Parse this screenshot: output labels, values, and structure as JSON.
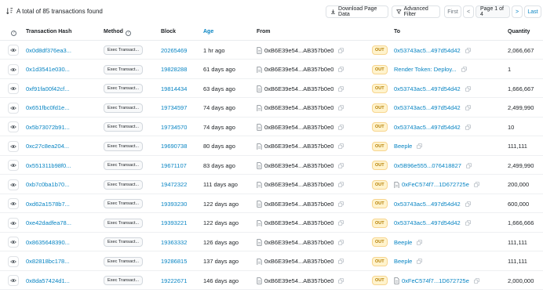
{
  "header": {
    "summary": "A total of 85 transactions found",
    "download_label": "Download Page Data",
    "filter_label": "Advanced Filter",
    "pager": {
      "first": "First",
      "prev": "<",
      "page": "Page 1 of 4",
      "next": ">",
      "last": "Last"
    }
  },
  "columns": {
    "hash": "Transaction Hash",
    "method": "Method",
    "block": "Block",
    "age": "Age",
    "from": "From",
    "to": "To",
    "quantity": "Quantity"
  },
  "rows": [
    {
      "hash": "0x0d8df376ea3...",
      "method": "Exec Transact...",
      "block": "20265469",
      "age": "1 hr ago",
      "from": "0xB6E39e54...AB357b0e0",
      "dir": "OUT",
      "to": "0x53743ac5...497d54d42",
      "to_contract": false,
      "qty": "2,066,667"
    },
    {
      "hash": "0x1d3541e030...",
      "method": "Exec Transact...",
      "block": "19828288",
      "age": "61 days ago",
      "from": "0xB6E39e54...AB357b0e0",
      "dir": "OUT",
      "to": "Render Token: Deploy...",
      "to_contract": false,
      "qty": "1"
    },
    {
      "hash": "0xf91fa00f42cf...",
      "method": "Exec Transact...",
      "block": "19814434",
      "age": "63 days ago",
      "from": "0xB6E39e54...AB357b0e0",
      "dir": "OUT",
      "to": "0x53743ac5...497d54d42",
      "to_contract": false,
      "qty": "1,666,667"
    },
    {
      "hash": "0x651fbc0fd1e...",
      "method": "Exec Transact...",
      "block": "19734597",
      "age": "74 days ago",
      "from": "0xB6E39e54...AB357b0e0",
      "dir": "OUT",
      "to": "0x53743ac5...497d54d42",
      "to_contract": false,
      "qty": "2,499,990"
    },
    {
      "hash": "0x5b73072b91...",
      "method": "Exec Transact...",
      "block": "19734570",
      "age": "74 days ago",
      "from": "0xB6E39e54...AB357b0e0",
      "dir": "OUT",
      "to": "0x53743ac5...497d54d42",
      "to_contract": false,
      "qty": "10"
    },
    {
      "hash": "0xc27c8ea204...",
      "method": "Exec Transact...",
      "block": "19690738",
      "age": "80 days ago",
      "from": "0xB6E39e54...AB357b0e0",
      "dir": "OUT",
      "to": "Beeple",
      "to_contract": false,
      "qty": "111,111"
    },
    {
      "hash": "0x551311b98f0...",
      "method": "Exec Transact...",
      "block": "19671107",
      "age": "83 days ago",
      "from": "0xB6E39e54...AB357b0e0",
      "dir": "OUT",
      "to": "0x5B96e555...076418827",
      "to_contract": false,
      "qty": "2,499,990"
    },
    {
      "hash": "0xb7c0ba1b70...",
      "method": "Exec Transact...",
      "block": "19472322",
      "age": "111 days ago",
      "from": "0xB6E39e54...AB357b0e0",
      "dir": "OUT",
      "to": "0xFeC574f7...1D672725e",
      "to_contract": true,
      "qty": "200,000"
    },
    {
      "hash": "0xd62a1578b7...",
      "method": "Exec Transact...",
      "block": "19393230",
      "age": "122 days ago",
      "from": "0xB6E39e54...AB357b0e0",
      "dir": "OUT",
      "to": "0x53743ac5...497d54d42",
      "to_contract": false,
      "qty": "600,000"
    },
    {
      "hash": "0xe42dadfea78...",
      "method": "Exec Transact...",
      "block": "19393221",
      "age": "122 days ago",
      "from": "0xB6E39e54...AB357b0e0",
      "dir": "OUT",
      "to": "0x53743ac5...497d54d42",
      "to_contract": false,
      "qty": "1,666,666"
    },
    {
      "hash": "0x8635648390...",
      "method": "Exec Transact...",
      "block": "19363332",
      "age": "126 days ago",
      "from": "0xB6E39e54...AB357b0e0",
      "dir": "OUT",
      "to": "Beeple",
      "to_contract": false,
      "qty": "111,111"
    },
    {
      "hash": "0x82818bc178...",
      "method": "Exec Transact...",
      "block": "19286815",
      "age": "137 days ago",
      "from": "0xB6E39e54...AB357b0e0",
      "dir": "OUT",
      "to": "Beeple",
      "to_contract": false,
      "qty": "111,111"
    },
    {
      "hash": "0x8da57424d1...",
      "method": "Exec Transact...",
      "block": "19222671",
      "age": "146 days ago",
      "from": "0xB6E39e54...AB357b0e0",
      "dir": "OUT",
      "to": "0xFeC574f7...1D672725e",
      "to_contract": true,
      "qty": "2,000,000"
    }
  ]
}
